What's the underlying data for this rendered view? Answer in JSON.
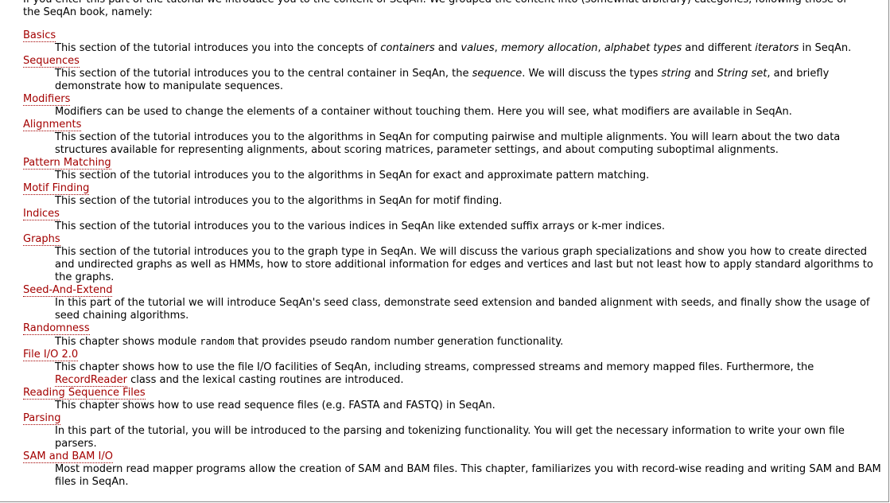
{
  "intro": {
    "line1": "If you enter this part of the tutorial we introduce you to the content of SeqAn. We grouped the content into (somewhat arbitrary) categories, following those of",
    "line2": "the SeqAn book, namely:"
  },
  "sections": [
    {
      "title": "Basics",
      "desc": {
        "t1": "This section of the tutorial introduces you into the concepts of ",
        "e1": "containers",
        "t2": " and ",
        "e2": "values",
        "t3": ", ",
        "e3": "memory allocation",
        "t4": ", ",
        "e4": "alphabet types",
        "t5": " and different ",
        "e5": "iterators",
        "t6": " in SeqAn."
      }
    },
    {
      "title": "Sequences",
      "desc": {
        "t1": "This section of the tutorial introduces you to the central container in SeqAn, the ",
        "e1": "sequence",
        "t2": ". We will discuss the types ",
        "e2": "string",
        "t3": " and ",
        "e3": "String set",
        "t4": ", and briefly demonstrate how to manipulate sequences."
      }
    },
    {
      "title": "Modifiers",
      "desc": "Modifiers can be used to change the elements of a container without touching them. Here you will see, what modifiers are available in SeqAn."
    },
    {
      "title": "Alignments",
      "desc": "This section of the tutorial introduces you to the algorithms in SeqAn for computing pairwise and multiple alignments. You will learn about the two data structures available for representing alignments, about scoring matrices, parameter settings, and about computing suboptimal alignments."
    },
    {
      "title": "Pattern Matching",
      "desc": "This section of the tutorial introduces you to the algorithms in SeqAn for exact and approximate pattern matching."
    },
    {
      "title": "Motif Finding",
      "desc": "This section of the tutorial introduces you to the algorithms in SeqAn for motif finding."
    },
    {
      "title": "Indices",
      "desc": "This section of the tutorial introduces you to the various indices in SeqAn like extended suffix arrays or k-mer indices."
    },
    {
      "title": "Graphs",
      "desc": "This section of the tutorial introduces you to the graph type in SeqAn. We will discuss the various graph specializations and show you how to create directed and undirected graphs as well as HMMs, how to store additional information for edges and vertices and last but not least how to apply standard algorithms to the graphs."
    },
    {
      "title": "Seed-And-Extend",
      "desc": "In this part of the tutorial we will introduce SeqAn's seed class, demonstrate seed extension and banded alignment with seeds, and finally show the usage of seed chaining algorithms."
    },
    {
      "title": "Randomness",
      "desc": {
        "t1": "This chapter shows module ",
        "code": "random",
        "t2": " that provides pseudo random number generation functionality."
      }
    },
    {
      "title": "File I/O 2.0",
      "desc": {
        "t1": "This chapter shows how to use the file I/O facilities of SeqAn, including streams, compressed streams and memory mapped files. Furthermore, the ",
        "link": "RecordReader",
        "t2": " class and the lexical casting routines are introduced."
      }
    },
    {
      "title": "Reading Sequence Files",
      "desc": "This chapter shows how to use read sequence files (e.g. FASTA and FASTQ) in SeqAn."
    },
    {
      "title": "Parsing",
      "desc": "In this part of the tutorial, you will be introduced to the parsing and tokenizing functionality. You will get the necessary information to write your own file parsers."
    },
    {
      "title": "SAM and BAM I/O",
      "desc": "Most modern read mapper programs allow the creation of SAM and BAM files. This chapter, familiarizes you with record-wise reading and writing SAM and BAM files in SeqAn."
    }
  ],
  "colors": {
    "link": "#a30000",
    "text": "#000000",
    "background": "#ffffff"
  }
}
